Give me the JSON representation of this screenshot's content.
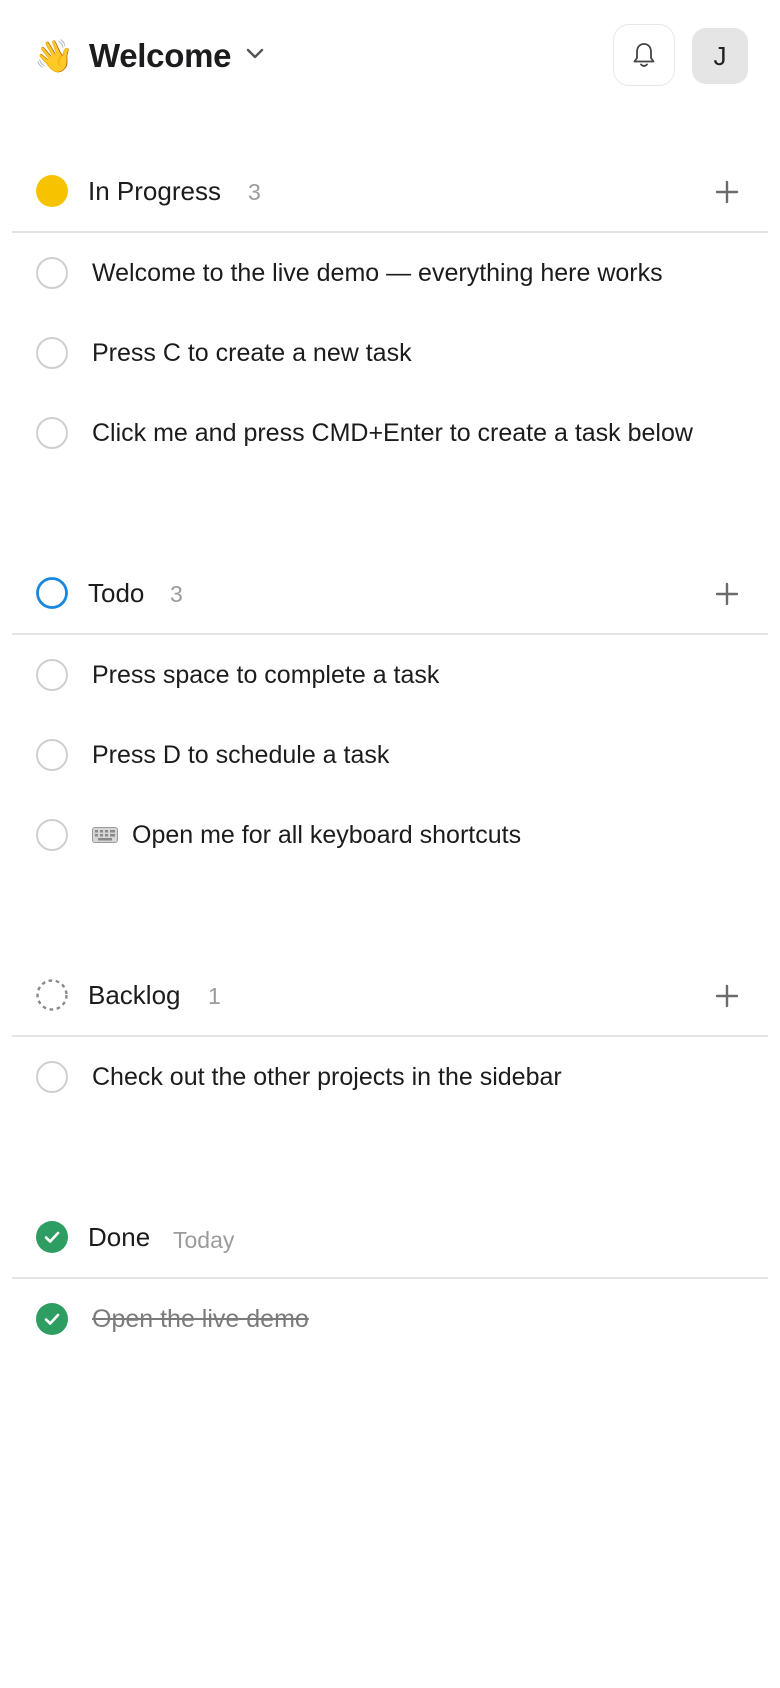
{
  "header": {
    "emoji": "👋",
    "title": "Welcome",
    "avatar_initial": "J"
  },
  "colors": {
    "in_progress": "#f7c300",
    "todo": "#1787e0",
    "backlog": "#8a8a8a",
    "done": "#2e9d62"
  },
  "sections": {
    "in_progress": {
      "label": "In Progress",
      "count": "3",
      "tasks": [
        "Welcome to the live demo — everything here works",
        "Press C to create a new task",
        "Click me and press CMD+Enter to create a task below"
      ]
    },
    "todo": {
      "label": "Todo",
      "count": "3",
      "tasks": [
        "Press space to complete a task",
        "Press D to schedule a task",
        "Open me for all keyboard shortcuts"
      ],
      "task_icon": "keyboard-icon"
    },
    "backlog": {
      "label": "Backlog",
      "count": "1",
      "tasks": [
        "Check out the other projects in the sidebar"
      ]
    },
    "done": {
      "label": "Done",
      "count": "Today",
      "tasks": [
        "Open the live demo"
      ]
    }
  }
}
